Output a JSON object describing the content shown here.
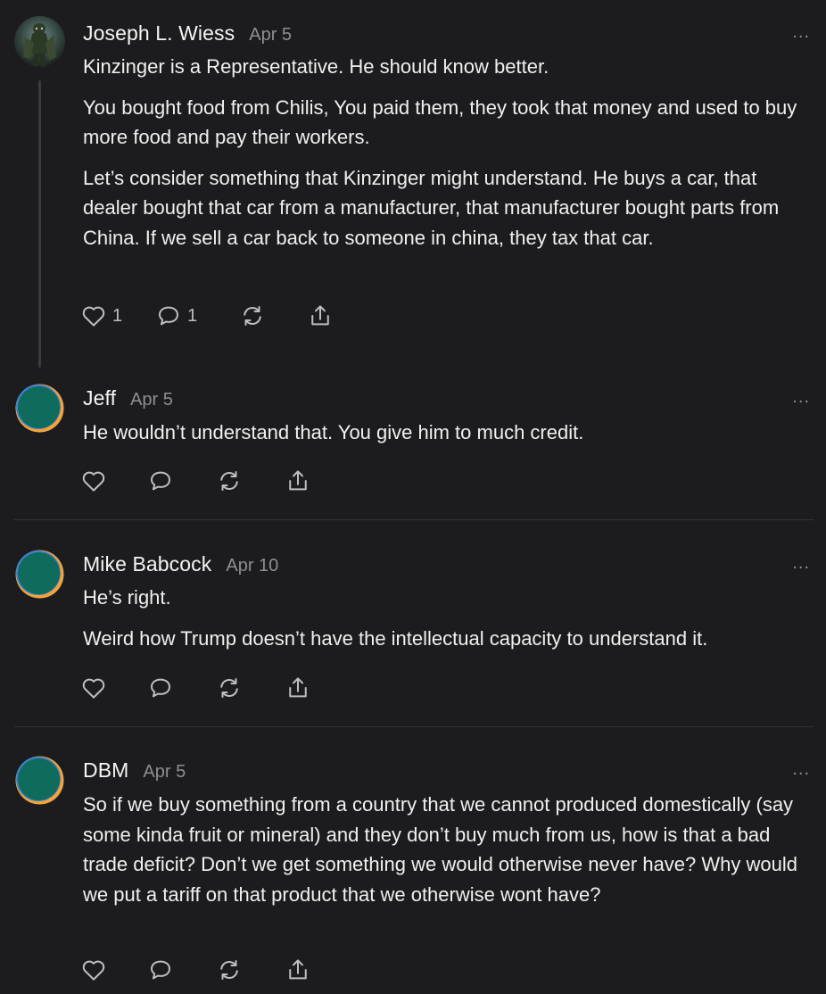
{
  "colors": {
    "background": "#1c1c1e",
    "text": "#f0f0f0",
    "muted": "#8e8e93",
    "icon": "#bdbdc2",
    "avatar_teal": "#0f6b5c",
    "avatar_orange": "#f2a33a",
    "avatar_blue": "#3f7fd0"
  },
  "more_label": "...",
  "comments": [
    {
      "author": "Joseph L. Wiess",
      "date": "Apr 5",
      "avatar": "photo-avatar",
      "paragraphs": [
        "Kinzinger is a Representative. He should know better.",
        "You bought food from Chilis, You paid them, they took that money and used to buy more food and pay their workers.",
        "Let’s consider something that Kinzinger might understand. He buys a car, that dealer bought that car from a manufacturer, that manufacturer bought parts from China. If we sell a car back to someone in china, they tax that car."
      ],
      "like_count": "1",
      "reply_count": "1"
    },
    {
      "author": "Jeff",
      "date": "Apr 5",
      "avatar": "default-avatar",
      "paragraphs": [
        "He wouldn’t understand that. You give him to much credit."
      ]
    },
    {
      "author": "Mike Babcock",
      "date": "Apr 10",
      "avatar": "default-avatar",
      "paragraphs": [
        "He’s right.",
        "Weird how Trump doesn’t have the intellectual capacity to understand it."
      ]
    },
    {
      "author": "DBM",
      "date": "Apr 5",
      "avatar": "default-avatar",
      "paragraphs": [
        "So if we buy something from a country that we cannot produced domestically (say some kinda fruit or mineral) and they don’t buy much from us, how is that a bad trade deficit? Don’t we get something we would otherwise never have? Why would we put a tariff on that product that we otherwise wont have?"
      ]
    }
  ],
  "icons": {
    "like": "heart-icon",
    "reply": "speech-bubble-icon",
    "restack": "restack-arrows-icon",
    "share": "share-upload-icon",
    "more": "more-dots-icon"
  }
}
